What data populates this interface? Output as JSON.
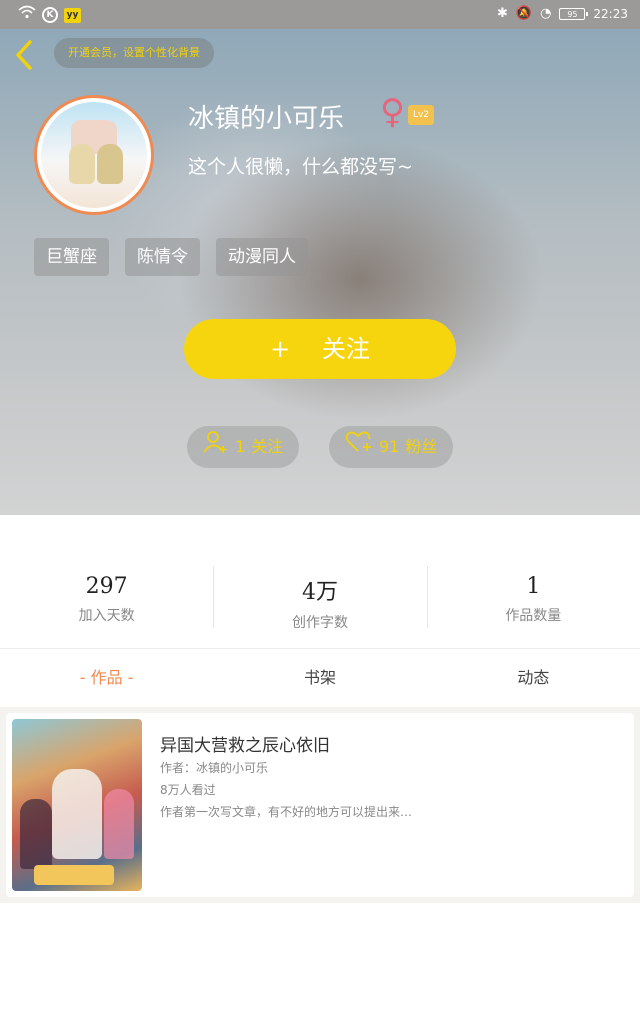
{
  "status_bar": {
    "time": "22:23",
    "battery": "95",
    "left_icons": [
      "wifi-icon",
      "k-app-icon",
      "yy-app-icon"
    ],
    "right_icons": [
      "bluetooth-icon",
      "mute-icon",
      "speed-icon",
      "battery-icon"
    ]
  },
  "header": {
    "back_icon": "chevron-left-icon",
    "vip_banner": "开通会员，设置个性化背景",
    "username": "冰镇的小可乐",
    "gender_symbol": "♀",
    "level": "Lv2",
    "bio": "这个人很懒，什么都没写~",
    "tags": [
      "巨蟹座",
      "陈情令",
      "动漫同人"
    ],
    "follow_button": {
      "plus": "+",
      "label": "关注"
    },
    "following": {
      "icon": "user-add-icon",
      "count": "1",
      "label": "关注"
    },
    "fans": {
      "icon": "heart-add-icon",
      "count": "91",
      "label": "粉丝"
    }
  },
  "stats": [
    {
      "value": "297",
      "label": "加入天数"
    },
    {
      "value": "4万",
      "label": "创作字数"
    },
    {
      "value": "1",
      "label": "作品数量"
    }
  ],
  "tabs": [
    {
      "label": "- 作品 -",
      "active": true
    },
    {
      "label": "书架",
      "active": false
    },
    {
      "label": "动态",
      "active": false
    }
  ],
  "works": [
    {
      "title": "异国大营救之辰心依旧",
      "author": "作者：冰镇的小可乐",
      "views": "8万人看过",
      "description": "作者第一次写文章，有不好的地方可以提出来…"
    }
  ],
  "colors": {
    "accent_yellow": "#f6d50f",
    "accent_orange": "#ef8a52",
    "gender_pink": "#e8647a"
  }
}
